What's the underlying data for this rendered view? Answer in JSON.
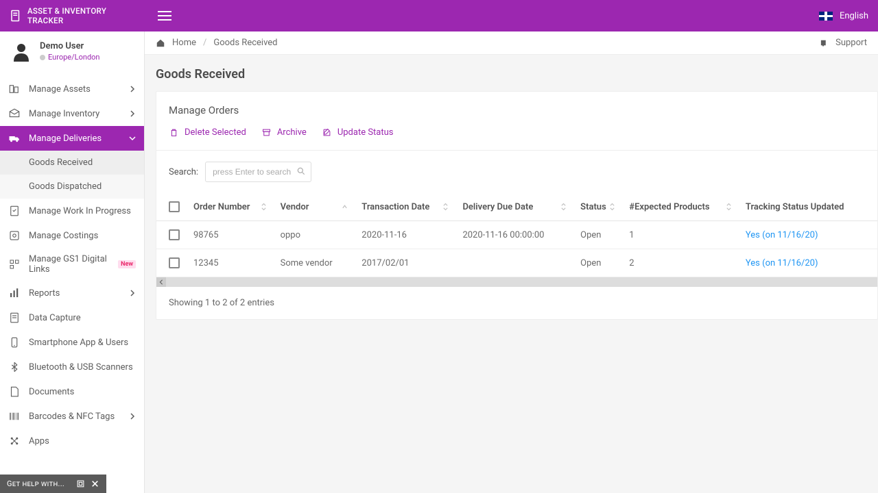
{
  "app": {
    "title": "ASSET & INVENTORY TRACKER",
    "language": "English"
  },
  "user": {
    "name": "Demo User",
    "timezone": "Europe/London"
  },
  "sidebar": {
    "items": [
      {
        "label": "Manage Assets",
        "expandable": true
      },
      {
        "label": "Manage Inventory",
        "expandable": true
      },
      {
        "label": "Manage Deliveries",
        "expandable": true,
        "active": true
      },
      {
        "label": "Manage Work In Progress"
      },
      {
        "label": "Manage Costings"
      },
      {
        "label": "Manage GS1 Digital Links",
        "badge": "New"
      },
      {
        "label": "Reports",
        "expandable": true
      },
      {
        "label": "Data Capture"
      },
      {
        "label": "Smartphone App & Users"
      },
      {
        "label": "Bluetooth & USB Scanners"
      },
      {
        "label": "Documents"
      },
      {
        "label": "Barcodes & NFC Tags",
        "expandable": true
      },
      {
        "label": "Apps"
      }
    ],
    "sub_items": [
      {
        "label": "Goods Received",
        "active": true
      },
      {
        "label": "Goods Dispatched"
      }
    ]
  },
  "help": {
    "label": "Get help with..."
  },
  "breadcrumb": {
    "home": "Home",
    "current": "Goods Received",
    "support": "Support"
  },
  "page": {
    "title": "Goods Received"
  },
  "panel": {
    "title": "Manage Orders",
    "actions": {
      "delete": "Delete Selected",
      "archive": "Archive",
      "update": "Update Status"
    },
    "search_label": "Search:",
    "search_placeholder": "press Enter to search"
  },
  "table": {
    "columns": [
      "Order Number",
      "Vendor",
      "Transaction Date",
      "Delivery Due Date",
      "Status",
      "#Expected Products",
      "Tracking Status Updated"
    ],
    "rows": [
      {
        "order": "98765",
        "vendor": "oppo",
        "transaction": "2020-11-16",
        "due": "2020-11-16 00:00:00",
        "status": "Open",
        "expected": "1",
        "tracking": "Yes (on 11/16/20)"
      },
      {
        "order": "12345",
        "vendor": "Some vendor",
        "transaction": "2017/02/01",
        "due": "",
        "status": "Open",
        "expected": "2",
        "tracking": "Yes (on 11/16/20)"
      }
    ],
    "footer": "Showing 1 to 2 of 2 entries"
  }
}
